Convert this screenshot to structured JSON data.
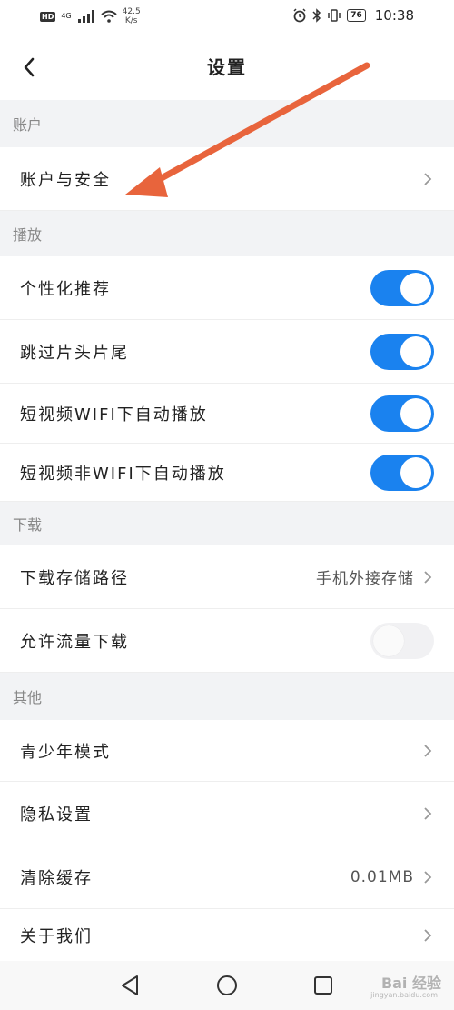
{
  "status_bar": {
    "network_badge": "HD",
    "network_type": "4G",
    "speed_value": "42.5",
    "speed_unit": "K/s",
    "battery": "76",
    "time": "10:38"
  },
  "nav": {
    "title": "设置"
  },
  "sections": {
    "account": {
      "header": "账户",
      "items": [
        {
          "label": "账户与安全"
        }
      ]
    },
    "playback": {
      "header": "播放",
      "items": [
        {
          "label": "个性化推荐",
          "toggle": true
        },
        {
          "label": "跳过片头片尾",
          "toggle": true
        },
        {
          "label": "短视频WIFI下自动播放",
          "toggle": true
        },
        {
          "label": "短视频非WIFI下自动播放",
          "toggle": true
        }
      ]
    },
    "download": {
      "header": "下载",
      "items": [
        {
          "label": "下载存储路径",
          "value": "手机外接存储"
        },
        {
          "label": "允许流量下载",
          "toggle": false
        }
      ]
    },
    "other": {
      "header": "其他",
      "items": [
        {
          "label": "青少年模式"
        },
        {
          "label": "隐私设置"
        },
        {
          "label": "清除缓存",
          "value": "0.01MB"
        },
        {
          "label": "关于我们"
        }
      ]
    }
  },
  "colors": {
    "toggle_on": "#1a82ef",
    "toggle_off": "#f1f1f3",
    "annotation_arrow": "#e8643c"
  },
  "watermark": {
    "text": "Bai 经验",
    "sub": "jingyan.baidu.com"
  }
}
